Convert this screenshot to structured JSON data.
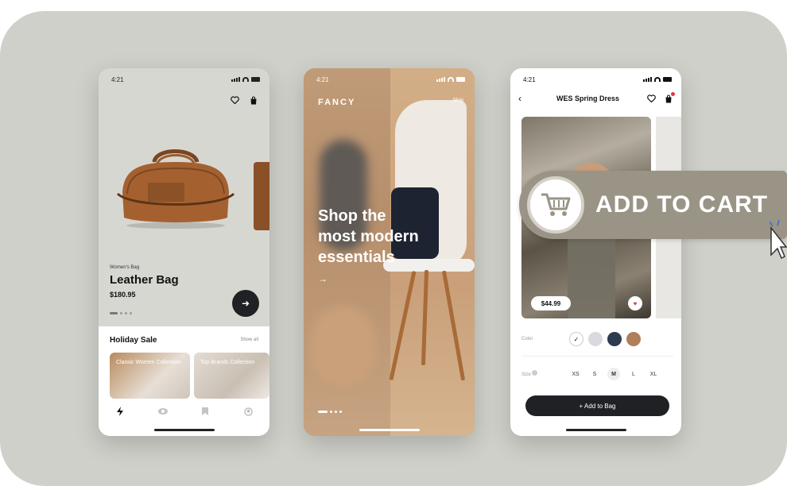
{
  "phone1": {
    "time": "4:21",
    "category": "Women's Bag",
    "title": "Leather Bag",
    "price": "$180.95",
    "sale_title": "Holiday Sale",
    "show_all": "Show all",
    "tiles": [
      "Classic Women Collection",
      "Top Brands Collection"
    ],
    "tab_icons": [
      "bolt-icon",
      "eye-icon",
      "bookmark-icon",
      "profile-icon"
    ]
  },
  "phone2": {
    "time": "4:21",
    "brand": "FANCY",
    "skip": "Skip",
    "hero_lines": [
      "Shop the",
      "most modern",
      "essentials"
    ],
    "arrow": "→"
  },
  "phone3": {
    "time": "4:21",
    "title": "WES Spring Dress",
    "price": "$44.99",
    "color_label": "Color",
    "colors": [
      "#ffffff",
      "#d8dadf",
      "#2d3a4f",
      "#b07e58"
    ],
    "size_label": "Size",
    "sizes": [
      "XS",
      "S",
      "M",
      "L",
      "XL"
    ],
    "selected_size": "M",
    "add_button": "+ Add to Bag"
  },
  "overlay": {
    "label": "ADD TO CART",
    "icon": "cart-icon"
  }
}
